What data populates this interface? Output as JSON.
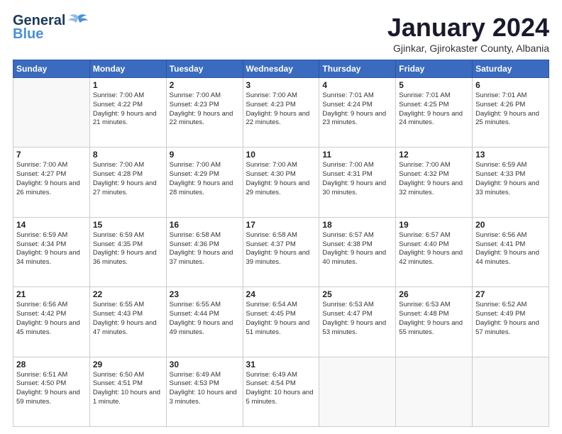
{
  "header": {
    "logo_general": "General",
    "logo_blue": "Blue",
    "month_title": "January 2024",
    "location": "Gjinkar, Gjirokaster County, Albania"
  },
  "calendar": {
    "weekdays": [
      "Sunday",
      "Monday",
      "Tuesday",
      "Wednesday",
      "Thursday",
      "Friday",
      "Saturday"
    ],
    "weeks": [
      [
        {
          "day": "",
          "sunrise": "",
          "sunset": "",
          "daylight": ""
        },
        {
          "day": "1",
          "sunrise": "Sunrise: 7:00 AM",
          "sunset": "Sunset: 4:22 PM",
          "daylight": "Daylight: 9 hours and 21 minutes."
        },
        {
          "day": "2",
          "sunrise": "Sunrise: 7:00 AM",
          "sunset": "Sunset: 4:23 PM",
          "daylight": "Daylight: 9 hours and 22 minutes."
        },
        {
          "day": "3",
          "sunrise": "Sunrise: 7:00 AM",
          "sunset": "Sunset: 4:23 PM",
          "daylight": "Daylight: 9 hours and 22 minutes."
        },
        {
          "day": "4",
          "sunrise": "Sunrise: 7:01 AM",
          "sunset": "Sunset: 4:24 PM",
          "daylight": "Daylight: 9 hours and 23 minutes."
        },
        {
          "day": "5",
          "sunrise": "Sunrise: 7:01 AM",
          "sunset": "Sunset: 4:25 PM",
          "daylight": "Daylight: 9 hours and 24 minutes."
        },
        {
          "day": "6",
          "sunrise": "Sunrise: 7:01 AM",
          "sunset": "Sunset: 4:26 PM",
          "daylight": "Daylight: 9 hours and 25 minutes."
        }
      ],
      [
        {
          "day": "7",
          "sunrise": "Sunrise: 7:00 AM",
          "sunset": "Sunset: 4:27 PM",
          "daylight": "Daylight: 9 hours and 26 minutes."
        },
        {
          "day": "8",
          "sunrise": "Sunrise: 7:00 AM",
          "sunset": "Sunset: 4:28 PM",
          "daylight": "Daylight: 9 hours and 27 minutes."
        },
        {
          "day": "9",
          "sunrise": "Sunrise: 7:00 AM",
          "sunset": "Sunset: 4:29 PM",
          "daylight": "Daylight: 9 hours and 28 minutes."
        },
        {
          "day": "10",
          "sunrise": "Sunrise: 7:00 AM",
          "sunset": "Sunset: 4:30 PM",
          "daylight": "Daylight: 9 hours and 29 minutes."
        },
        {
          "day": "11",
          "sunrise": "Sunrise: 7:00 AM",
          "sunset": "Sunset: 4:31 PM",
          "daylight": "Daylight: 9 hours and 30 minutes."
        },
        {
          "day": "12",
          "sunrise": "Sunrise: 7:00 AM",
          "sunset": "Sunset: 4:32 PM",
          "daylight": "Daylight: 9 hours and 32 minutes."
        },
        {
          "day": "13",
          "sunrise": "Sunrise: 6:59 AM",
          "sunset": "Sunset: 4:33 PM",
          "daylight": "Daylight: 9 hours and 33 minutes."
        }
      ],
      [
        {
          "day": "14",
          "sunrise": "Sunrise: 6:59 AM",
          "sunset": "Sunset: 4:34 PM",
          "daylight": "Daylight: 9 hours and 34 minutes."
        },
        {
          "day": "15",
          "sunrise": "Sunrise: 6:59 AM",
          "sunset": "Sunset: 4:35 PM",
          "daylight": "Daylight: 9 hours and 36 minutes."
        },
        {
          "day": "16",
          "sunrise": "Sunrise: 6:58 AM",
          "sunset": "Sunset: 4:36 PM",
          "daylight": "Daylight: 9 hours and 37 minutes."
        },
        {
          "day": "17",
          "sunrise": "Sunrise: 6:58 AM",
          "sunset": "Sunset: 4:37 PM",
          "daylight": "Daylight: 9 hours and 39 minutes."
        },
        {
          "day": "18",
          "sunrise": "Sunrise: 6:57 AM",
          "sunset": "Sunset: 4:38 PM",
          "daylight": "Daylight: 9 hours and 40 minutes."
        },
        {
          "day": "19",
          "sunrise": "Sunrise: 6:57 AM",
          "sunset": "Sunset: 4:40 PM",
          "daylight": "Daylight: 9 hours and 42 minutes."
        },
        {
          "day": "20",
          "sunrise": "Sunrise: 6:56 AM",
          "sunset": "Sunset: 4:41 PM",
          "daylight": "Daylight: 9 hours and 44 minutes."
        }
      ],
      [
        {
          "day": "21",
          "sunrise": "Sunrise: 6:56 AM",
          "sunset": "Sunset: 4:42 PM",
          "daylight": "Daylight: 9 hours and 45 minutes."
        },
        {
          "day": "22",
          "sunrise": "Sunrise: 6:55 AM",
          "sunset": "Sunset: 4:43 PM",
          "daylight": "Daylight: 9 hours and 47 minutes."
        },
        {
          "day": "23",
          "sunrise": "Sunrise: 6:55 AM",
          "sunset": "Sunset: 4:44 PM",
          "daylight": "Daylight: 9 hours and 49 minutes."
        },
        {
          "day": "24",
          "sunrise": "Sunrise: 6:54 AM",
          "sunset": "Sunset: 4:45 PM",
          "daylight": "Daylight: 9 hours and 51 minutes."
        },
        {
          "day": "25",
          "sunrise": "Sunrise: 6:53 AM",
          "sunset": "Sunset: 4:47 PM",
          "daylight": "Daylight: 9 hours and 53 minutes."
        },
        {
          "day": "26",
          "sunrise": "Sunrise: 6:53 AM",
          "sunset": "Sunset: 4:48 PM",
          "daylight": "Daylight: 9 hours and 55 minutes."
        },
        {
          "day": "27",
          "sunrise": "Sunrise: 6:52 AM",
          "sunset": "Sunset: 4:49 PM",
          "daylight": "Daylight: 9 hours and 57 minutes."
        }
      ],
      [
        {
          "day": "28",
          "sunrise": "Sunrise: 6:51 AM",
          "sunset": "Sunset: 4:50 PM",
          "daylight": "Daylight: 9 hours and 59 minutes."
        },
        {
          "day": "29",
          "sunrise": "Sunrise: 6:50 AM",
          "sunset": "Sunset: 4:51 PM",
          "daylight": "Daylight: 10 hours and 1 minute."
        },
        {
          "day": "30",
          "sunrise": "Sunrise: 6:49 AM",
          "sunset": "Sunset: 4:53 PM",
          "daylight": "Daylight: 10 hours and 3 minutes."
        },
        {
          "day": "31",
          "sunrise": "Sunrise: 6:49 AM",
          "sunset": "Sunset: 4:54 PM",
          "daylight": "Daylight: 10 hours and 5 minutes."
        },
        {
          "day": "",
          "sunrise": "",
          "sunset": "",
          "daylight": ""
        },
        {
          "day": "",
          "sunrise": "",
          "sunset": "",
          "daylight": ""
        },
        {
          "day": "",
          "sunrise": "",
          "sunset": "",
          "daylight": ""
        }
      ]
    ]
  }
}
